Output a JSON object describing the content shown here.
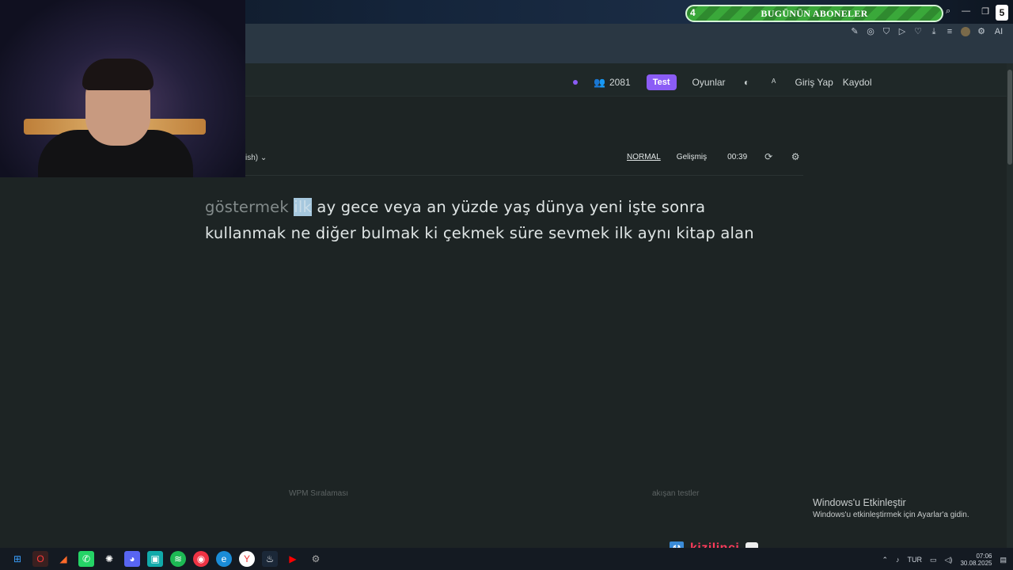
{
  "overlay": {
    "subscriber_count": "4",
    "subscriber_title": "BUGÜNÜN ABONELER",
    "corner_badge": "5"
  },
  "browser": {
    "ext_label": "AI"
  },
  "site": {
    "online_count": "2081",
    "test_label": "Test",
    "games_label": "Oyunlar",
    "login_label": "Giriş Yap",
    "register_label": "Kaydol"
  },
  "toolbar": {
    "language": "ish)",
    "mode_normal": "NORMAL",
    "mode_advanced": "Gelişmiş",
    "timer": "00:39"
  },
  "typing": {
    "typed_word": "göstermek",
    "current_word": "ilk",
    "line1_rest": "ay gece veya an yüzde yaş dünya yeni işte sonra",
    "line2": "kullanmak ne diğer bulmak ki çekmek süre sevmek ilk aynı kitap alan"
  },
  "stats": {
    "wpm_label": "WPM Sıralaması",
    "recent_label": "akışan testler"
  },
  "windows": {
    "activate_title": "Windows'u Etkinleştir",
    "activate_sub": "Windows'u etkinleştirmek için Ayarlar'a gidin."
  },
  "brand": {
    "name": "kizilinci"
  },
  "taskbar": {
    "lang": "TUR",
    "time": "07:06",
    "date": "30.08.2025"
  },
  "colors": {
    "accent": "#8b5cf6",
    "background": "#1d2424",
    "brand": "#ff3b5c"
  }
}
